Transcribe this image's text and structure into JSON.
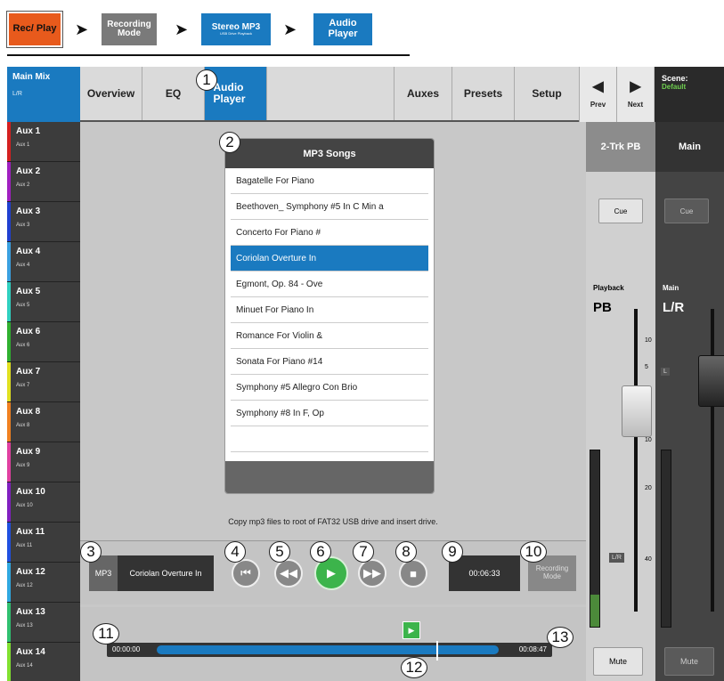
{
  "breadcrumb": {
    "items": [
      "Rec/ Play",
      "Recording Mode",
      "Stereo MP3",
      "Audio Player"
    ],
    "sub": "USB Drive Playback"
  },
  "sidebar": {
    "main_mix": {
      "label": "Main Mix",
      "sub": "L/R"
    },
    "aux": [
      {
        "label": "Aux 1",
        "sub": "Aux 1",
        "color": "#d42020"
      },
      {
        "label": "Aux 2",
        "sub": "Aux 2",
        "color": "#a020c0"
      },
      {
        "label": "Aux 3",
        "sub": "Aux 3",
        "color": "#2040d0"
      },
      {
        "label": "Aux 4",
        "sub": "Aux 4",
        "color": "#3aa0e0"
      },
      {
        "label": "Aux 5",
        "sub": "Aux 5",
        "color": "#30d0c0"
      },
      {
        "label": "Aux 6",
        "sub": "Aux 6",
        "color": "#30b030"
      },
      {
        "label": "Aux 7",
        "sub": "Aux 7",
        "color": "#e0e020"
      },
      {
        "label": "Aux 8",
        "sub": "Aux 8",
        "color": "#f08020"
      },
      {
        "label": "Aux 9",
        "sub": "Aux 9",
        "color": "#e040a0"
      },
      {
        "label": "Aux 10",
        "sub": "Aux 10",
        "color": "#8020c0"
      },
      {
        "label": "Aux 11",
        "sub": "Aux 11",
        "color": "#2050e0"
      },
      {
        "label": "Aux 12",
        "sub": "Aux 12",
        "color": "#30a8e0"
      },
      {
        "label": "Aux 13",
        "sub": "Aux 13",
        "color": "#30c070"
      },
      {
        "label": "Aux 14",
        "sub": "Aux 14",
        "color": "#80e030"
      }
    ]
  },
  "tabs": {
    "overview": "Overview",
    "eq": "EQ",
    "audio": "Audio Player",
    "auxes": "Auxes",
    "presets": "Presets",
    "setup": "Setup"
  },
  "nav": {
    "prev": "Prev",
    "next": "Next"
  },
  "scene": {
    "label": "Scene:",
    "value": "Default"
  },
  "playlist": {
    "title": "MP3 Songs",
    "songs": [
      "Bagatelle For Piano",
      "Beethoven_ Symphony #5 In C Min a",
      "Concerto For Piano #",
      "Coriolan Overture In",
      "Egmont, Op. 84 - Ove",
      "Minuet For Piano In",
      "Romance For Violin &",
      "Sonata For Piano #14",
      "Symphony #5 Allegro Con Brio",
      "Symphony #8 In F, Op"
    ],
    "selected_index": 3
  },
  "note": "Copy mp3 files to root of FAT32 USB drive and insert drive.",
  "transport": {
    "format": "MP3",
    "track": "Coriolan Overture In",
    "elapsed": "00:06:33",
    "rec_mode": "Recording Mode"
  },
  "timeline": {
    "start": "00:00:00",
    "end": "00:08:47",
    "position_fraction": 0.77
  },
  "callouts": [
    "1",
    "2",
    "3",
    "4",
    "5",
    "6",
    "7",
    "8",
    "9",
    "10",
    "11",
    "12",
    "13"
  ],
  "strips": {
    "pb": {
      "header": "2-Trk PB",
      "cue": "Cue",
      "label": "Playback",
      "name": "PB",
      "mute": "Mute",
      "lr": "L/R",
      "meter_level": 0.18
    },
    "main": {
      "header": "Main",
      "cue": "Cue",
      "label": "Main",
      "name": "L/R",
      "mute": "Mute",
      "l": "L",
      "meter_level": 0
    }
  },
  "scale": [
    "10",
    "5",
    "10",
    "20",
    "40"
  ],
  "colors": {
    "accent": "#1a7ac0",
    "play": "#3cb44b",
    "crumb_red": "#e85a1c",
    "crumb_gray": "#7a7a7a"
  }
}
